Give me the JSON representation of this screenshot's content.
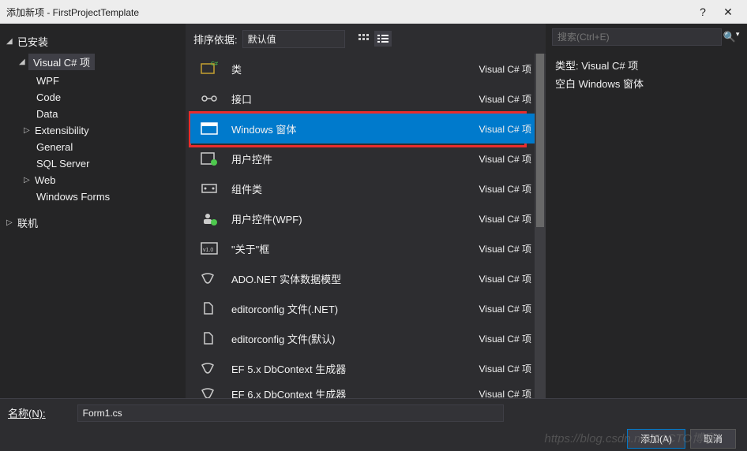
{
  "titlebar": {
    "title": "添加新项 - FirstProjectTemplate",
    "help": "?",
    "close": "✕"
  },
  "leftTree": {
    "installed": "已安装",
    "csharp": "Visual C# 项",
    "items": [
      "WPF",
      "Code",
      "Data",
      "Extensibility",
      "General",
      "SQL Server",
      "Web",
      "Windows Forms"
    ],
    "online": "联机"
  },
  "center": {
    "sortLabel": "排序依据:",
    "sortValue": "默认值",
    "items": [
      {
        "name": "类",
        "lang": "Visual C# 项"
      },
      {
        "name": "接口",
        "lang": "Visual C# 项"
      },
      {
        "name": "Windows 窗体",
        "lang": "Visual C# 项"
      },
      {
        "name": "用户控件",
        "lang": "Visual C# 项"
      },
      {
        "name": "组件类",
        "lang": "Visual C# 项"
      },
      {
        "name": "用户控件(WPF)",
        "lang": "Visual C# 项"
      },
      {
        "name": "\"关于\"框",
        "lang": "Visual C# 项"
      },
      {
        "name": "ADO.NET 实体数据模型",
        "lang": "Visual C# 项"
      },
      {
        "name": "editorconfig 文件(.NET)",
        "lang": "Visual C# 项"
      },
      {
        "name": "editorconfig 文件(默认)",
        "lang": "Visual C# 项"
      },
      {
        "name": "EF 5.x DbContext 生成器",
        "lang": "Visual C# 项"
      },
      {
        "name": "EF 6.x DbContext 生成器",
        "lang": "Visual C# 项"
      }
    ]
  },
  "right": {
    "searchPlaceholder": "搜索(Ctrl+E)",
    "typeLabel": "类型:",
    "typeValue": "Visual C# 项",
    "desc": "空白 Windows 窗体"
  },
  "bottom": {
    "nameLabel": "名称(N):",
    "nameValue": "Form1.cs"
  },
  "footer": {
    "add": "添加(A)",
    "cancel": "取消"
  },
  "watermark": "https://blog.csdn.net/51CTO博客"
}
